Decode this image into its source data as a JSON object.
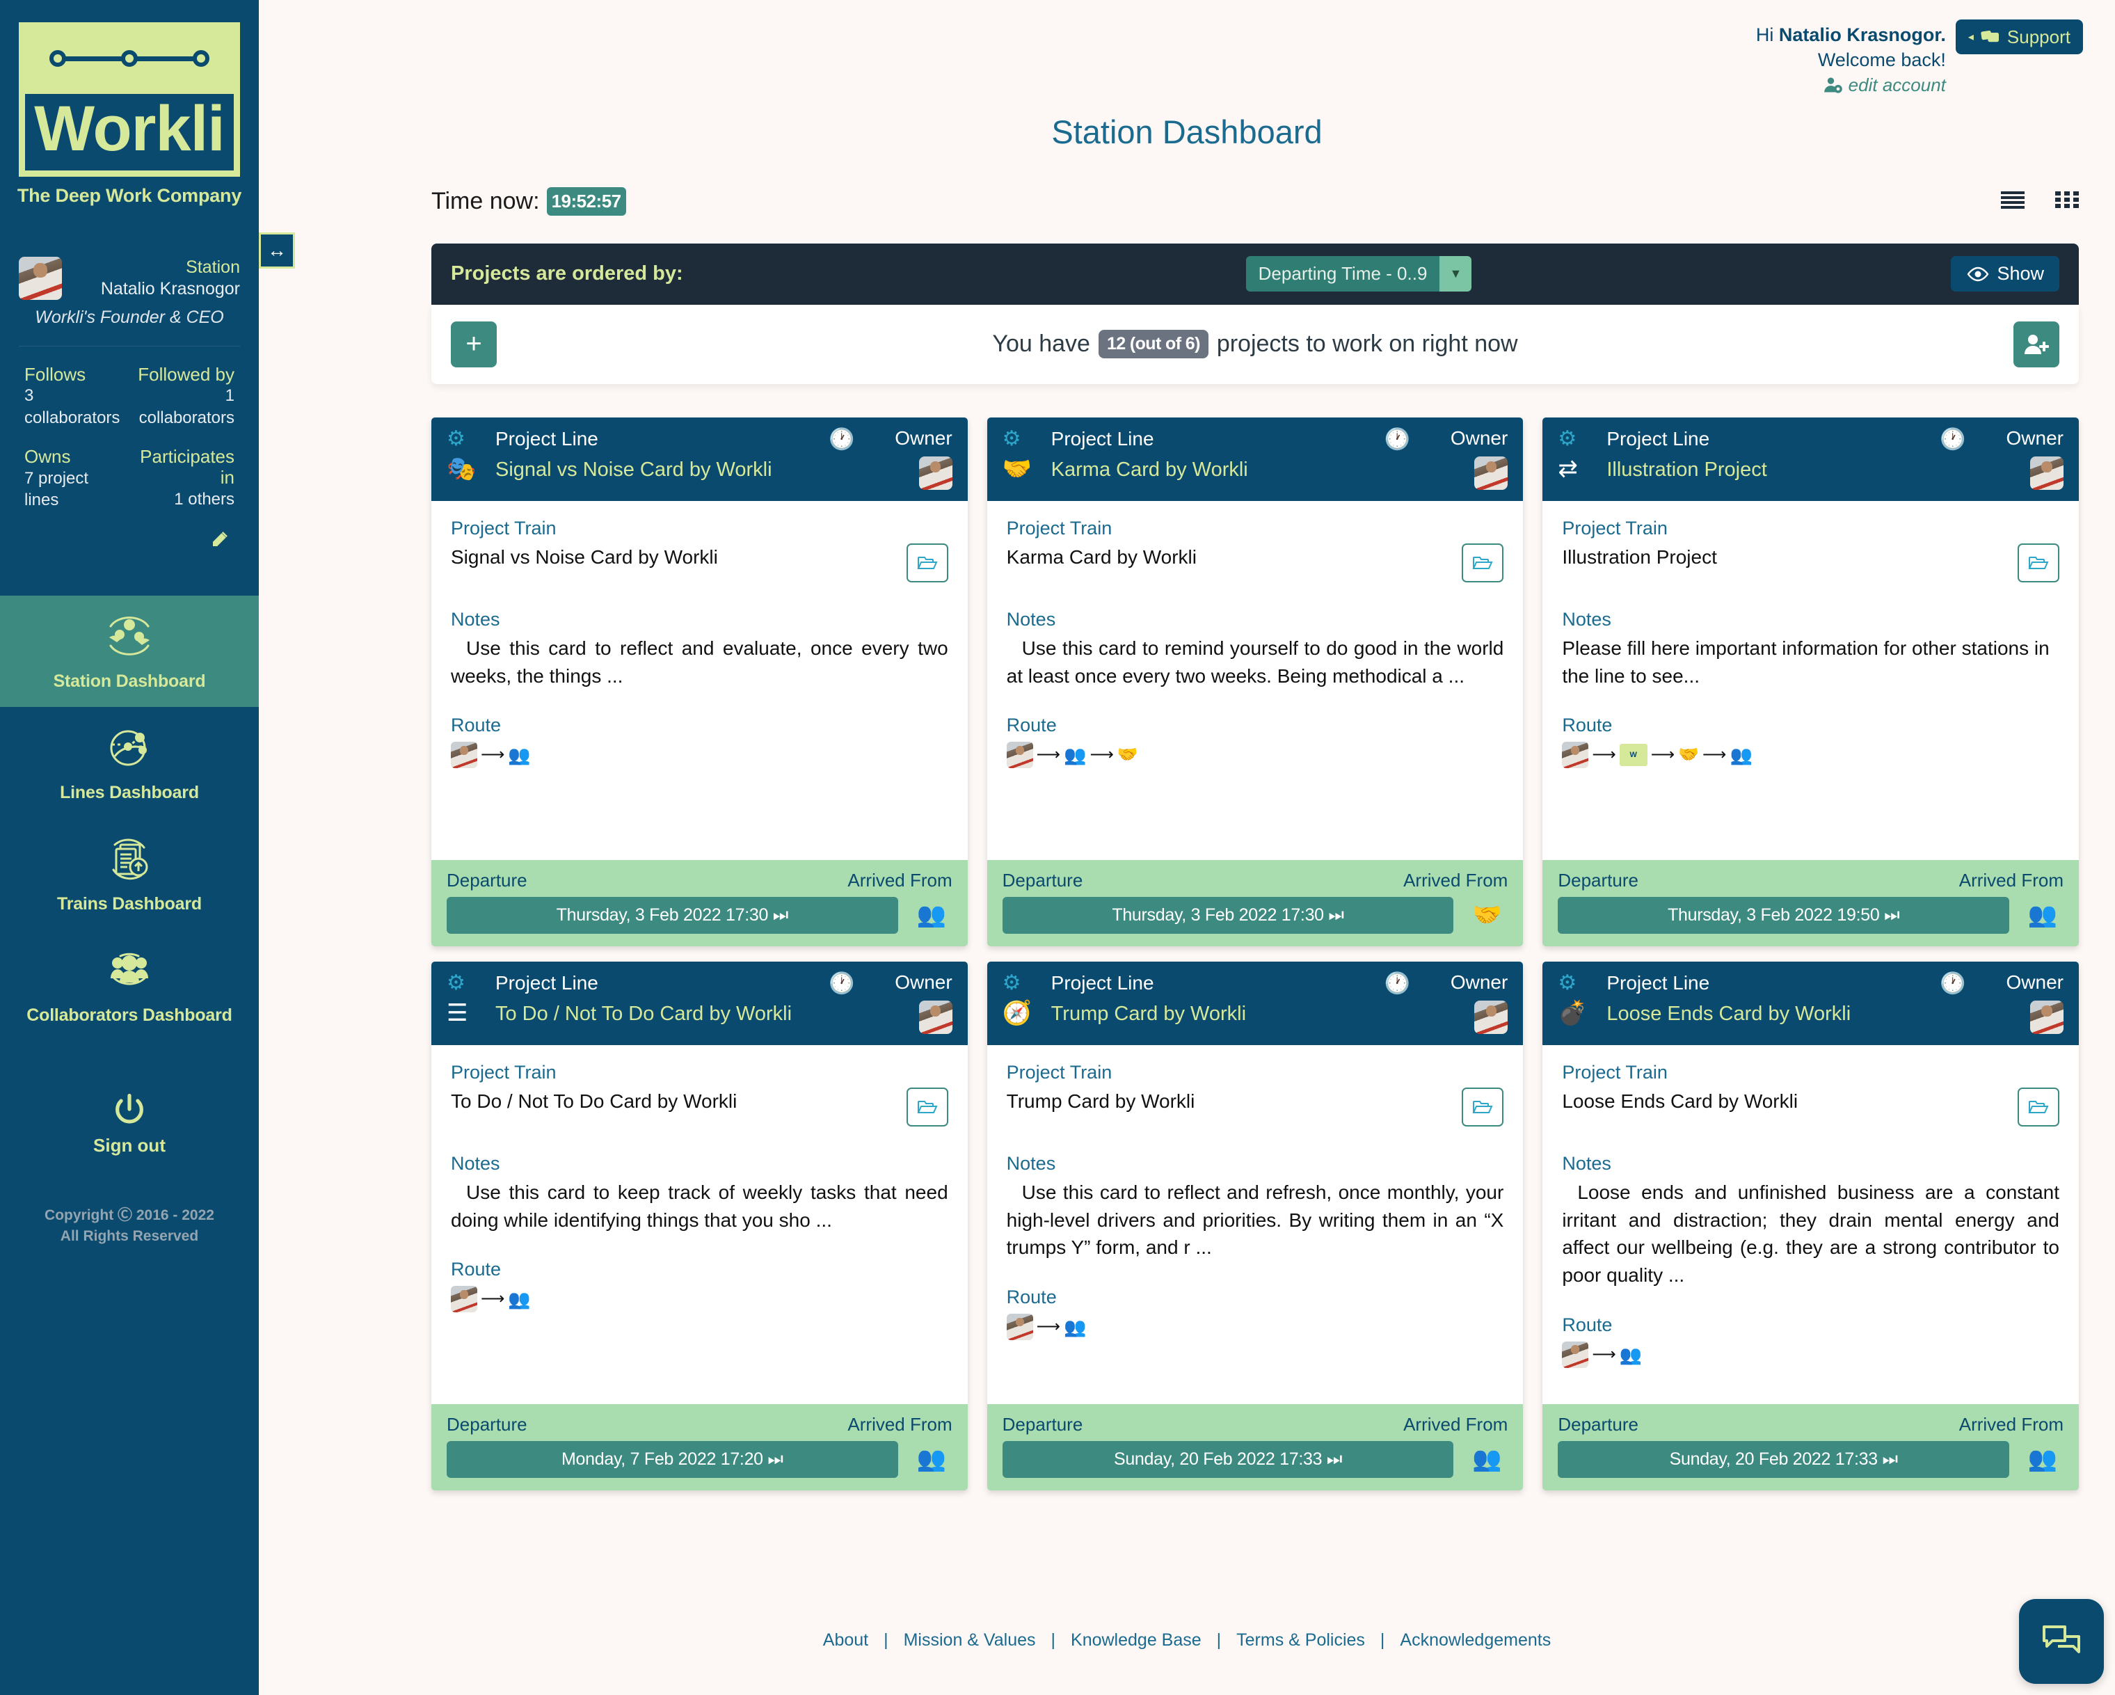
{
  "brand": {
    "name": "Workli",
    "tagline": "The Deep Work Company"
  },
  "sidebar": {
    "profile": {
      "station_label": "Station",
      "station_name": "Natalio Krasnogor",
      "role": "Workli's Founder & CEO"
    },
    "stats": [
      {
        "label": "Follows",
        "value": "3 collaborators"
      },
      {
        "label": "Followed by",
        "value": "1 collaborators"
      },
      {
        "label": "Owns",
        "value": "7 project lines"
      },
      {
        "label": "Participates in",
        "value": "1 others"
      }
    ],
    "nav": [
      {
        "label": "Station Dashboard",
        "icon": "station-dashboard-icon",
        "active": true
      },
      {
        "label": "Lines Dashboard",
        "icon": "lines-dashboard-icon",
        "active": false
      },
      {
        "label": "Trains Dashboard",
        "icon": "trains-dashboard-icon",
        "active": false
      },
      {
        "label": "Collaborators Dashboard",
        "icon": "collaborators-dashboard-icon",
        "active": false
      }
    ],
    "signout_label": "Sign out",
    "copyright_line1": "Copyright Ⓒ 2016 - 2022",
    "copyright_line2": "All Rights Reserved",
    "toggle_icon": "↔"
  },
  "header": {
    "greeting_prefix": "Hi ",
    "user_name": "Natalio Krasnogor.",
    "welcome": "Welcome back!",
    "edit_account": "edit account",
    "support_label": "Support",
    "page_title": "Station Dashboard"
  },
  "toolbar": {
    "time_now_label": "Time now:",
    "time_now_value": "19:52:57",
    "view_list_icon": "list-view-icon",
    "view_grid_icon": "grid-view-icon"
  },
  "order_panel": {
    "ordered_by_label": "Projects are ordered by:",
    "sort_value": "Departing Time - 0..9",
    "sort_options": [
      "Departing Time - 0..9"
    ],
    "show_label": "Show"
  },
  "count_panel": {
    "add_label": "+",
    "text_before": "You have",
    "count_badge": "12 (out of 6)",
    "text_after": "projects to work on right now",
    "add_collaborator_icon": "add-person-icon"
  },
  "labels": {
    "project_line": "Project Line",
    "owner": "Owner",
    "project_train": "Project Train",
    "notes": "Notes",
    "route": "Route",
    "departure": "Departure",
    "arrived_from": "Arrived From"
  },
  "cards": [
    {
      "type_icon": "masks-icon",
      "line_name": "Signal vs Noise Card by Workli",
      "train_name": "Signal vs Noise Card by Workli",
      "notes": "Use this card to reflect and evaluate, once every two weeks,  the things ...",
      "departure": "Thursday, 3 Feb 2022 17:30 ⏭",
      "arrived_icon": "handoff-people-icon",
      "route": [
        "avatar",
        "arrow",
        "people"
      ]
    },
    {
      "type_icon": "giving-hand-icon",
      "line_name": "Karma Card by Workli",
      "train_name": "Karma Card by Workli",
      "notes": "Use this card to remind yourself to do good in the world at least once every two weeks. Being methodical a ...",
      "departure": "Thursday, 3 Feb 2022 17:30 ⏭",
      "arrived_icon": "handshake-icon",
      "route": [
        "avatar",
        "arrow",
        "people",
        "arrow",
        "handshake"
      ]
    },
    {
      "type_icon": "exchange-arrows-icon",
      "line_name": "Illustration Project",
      "train_name": "Illustration Project",
      "notes": "Please fill here important information for other stations in the line to see...",
      "departure": "Thursday, 3 Feb 2022 19:50 ⏭",
      "arrived_icon": "handoff-people-icon",
      "route": [
        "avatar",
        "arrow",
        "logo",
        "arrow",
        "handshake",
        "arrow",
        "people"
      ]
    },
    {
      "type_icon": "list-icon",
      "line_name": "To Do / Not To Do Card by Workli",
      "train_name": "To Do / Not To Do Card by Workli",
      "notes": "Use this card to keep track of weekly tasks that need doing while identifying things that you sho ...",
      "departure": "Monday, 7 Feb 2022 17:20 ⏭",
      "arrived_icon": "handoff-people-icon",
      "route": [
        "avatar",
        "arrow",
        "people"
      ]
    },
    {
      "type_icon": "compass-icon",
      "line_name": "Trump Card by Workli",
      "train_name": "Trump Card by Workli",
      "notes": "Use this card to reflect and refresh, once monthly, your high-level drivers and priorities. By writing them in an “X trumps Y” form, and r ...",
      "departure": "Sunday, 20 Feb 2022 17:33 ⏭",
      "arrived_icon": "handoff-people-icon",
      "route": [
        "avatar",
        "arrow",
        "people"
      ]
    },
    {
      "type_icon": "bomb-icon",
      "line_name": "Loose Ends Card by Workli",
      "train_name": "Loose Ends Card by Workli",
      "notes": "Loose ends and unfinished business are a constant irritant and distraction; they drain mental energy and affect our wellbeing (e.g. they are a strong contributor to poor quality ...",
      "departure": "Sunday, 20 Feb 2022 17:33 ⏭",
      "arrived_icon": "handoff-people-icon",
      "route": [
        "avatar",
        "arrow",
        "people"
      ]
    }
  ],
  "footer": {
    "links": [
      "About",
      "Mission & Values",
      "Knowledge Base",
      "Terms & Policies",
      "Acknowledgements"
    ],
    "separator": "|"
  },
  "chat": {
    "icon": "chat-icon"
  },
  "colors": {
    "brand_blue": "#0b4a6f",
    "brand_green": "#d6e89a",
    "teal": "#3d8a80",
    "dark_panel": "#1e2b38",
    "card_foot": "#a9dcae"
  }
}
